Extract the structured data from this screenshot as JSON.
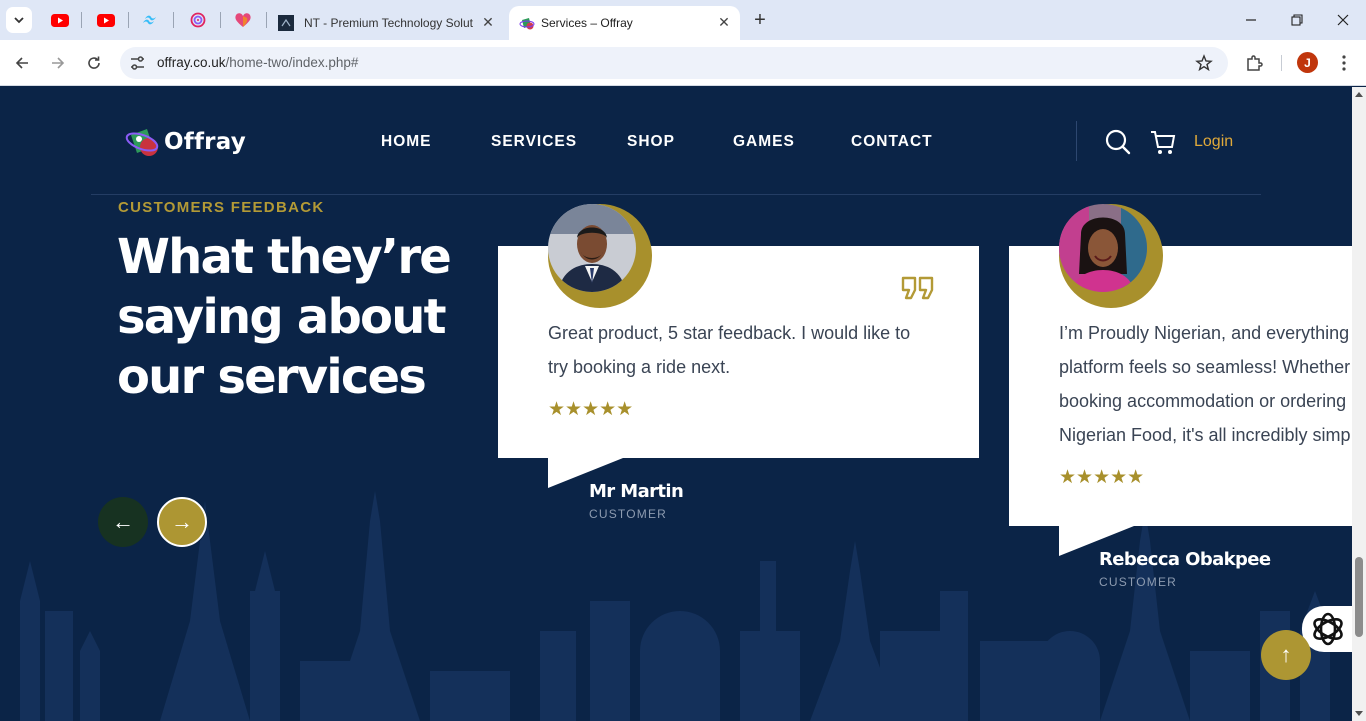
{
  "browser": {
    "tabs": [
      {
        "title": "NT - Premium Technology Solut",
        "active": false
      },
      {
        "title": "Services – Offray",
        "active": true
      }
    ],
    "address": {
      "host": "offray.co.uk",
      "path": "/home-two/index.php#"
    },
    "profile_initial": "J"
  },
  "header": {
    "logo_text": "Offray",
    "nav": [
      "HOME",
      "SERVICES",
      "SHOP",
      "GAMES",
      "CONTACT"
    ],
    "login": "Login"
  },
  "section": {
    "eyebrow": "CUSTOMERS FEEDBACK",
    "headline_lines": [
      "What they’re",
      "saying about",
      "our services"
    ],
    "prev_arrow": "←",
    "next_arrow": "→"
  },
  "testimonials": [
    {
      "text": "Great product, 5 star feedback. I would like to try booking a ride next.",
      "lines": [
        "Great product, 5 star feedback. I would like to",
        "try booking a ride next."
      ],
      "stars": "★★★★★",
      "rating": 5,
      "name": "Mr Martin",
      "role": "CUSTOMER"
    },
    {
      "text": "I’m Proudly Nigerian, and everything platform feels so seamless! Whether booking accommodation or ordering Nigerian Food, it's all incredibly simp",
      "lines": [
        "I’m Proudly Nigerian, and everything",
        "platform feels so seamless! Whether",
        "booking accommodation or ordering",
        "Nigerian Food, it's all incredibly simp"
      ],
      "stars": "★★★★★",
      "rating": 5,
      "name": "Rebecca Obakpee",
      "role": "CUSTOMER"
    }
  ],
  "floating": {
    "scroll_top": "↑"
  },
  "colors": {
    "background": "#0b2447",
    "gold": "#ad9633",
    "login": "#e0a93a",
    "prev_button": "#173221"
  }
}
